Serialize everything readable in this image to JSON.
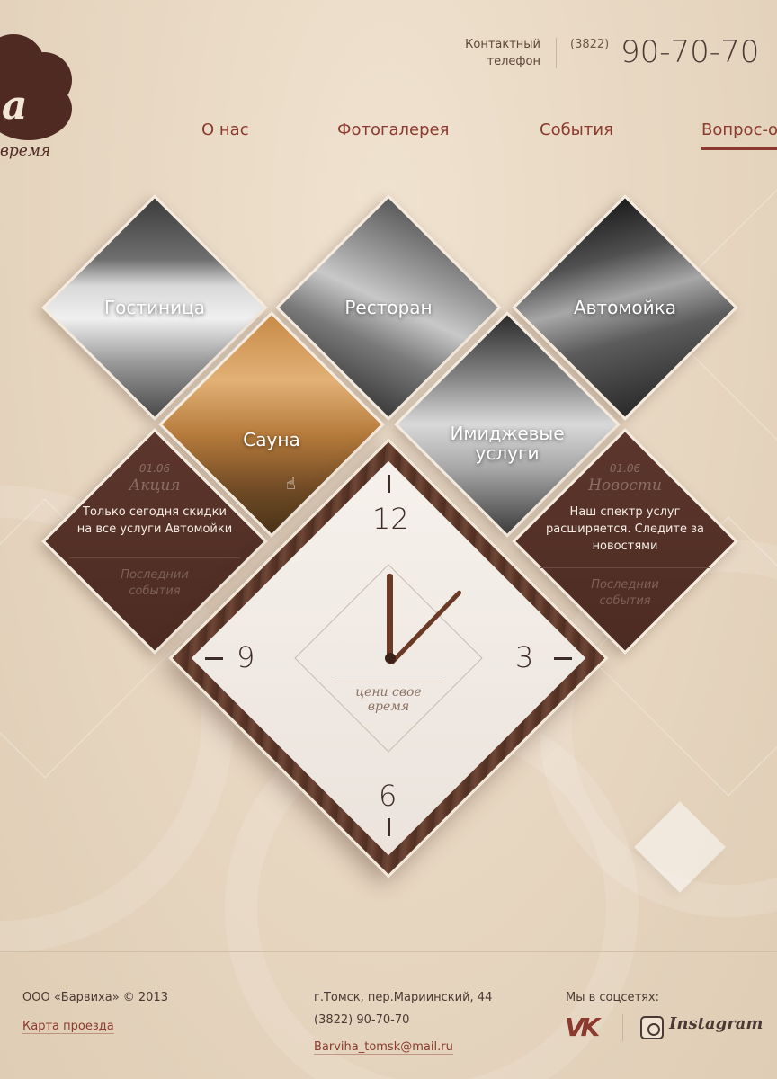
{
  "logo": {
    "letters": "a",
    "tagline": "время"
  },
  "contact": {
    "label_line1": "Контактный",
    "label_line2": "телефон",
    "code": "(3822)",
    "phone": "90-70-70"
  },
  "nav": {
    "items": [
      {
        "label": "О нас"
      },
      {
        "label": "Фотогалерея"
      },
      {
        "label": "События"
      },
      {
        "label": "Вопрос-о"
      }
    ],
    "active_index": 3
  },
  "tiles": {
    "hotel": "Гостиница",
    "restaurant": "Ресторан",
    "carwash": "Автомойка",
    "sauna": "Сауна",
    "image_services_line1": "Имиджевые",
    "image_services_line2": "услуги"
  },
  "promo": {
    "date": "01.06",
    "title": "Акция",
    "text_line1": "Только сегодня скидки",
    "text_line2": "на все услуги Автомойки",
    "more_line1": "Последнии",
    "more_line2": "события"
  },
  "news": {
    "date": "01.06",
    "title": "Новости",
    "text_line1": "Наш спектр услуг",
    "text_line2": "расширяется. Следите за",
    "text_line3": "новостями",
    "more_line1": "Последнии",
    "more_line2": "события"
  },
  "clock": {
    "n12": "12",
    "n3": "3",
    "n6": "6",
    "n9": "9",
    "motto_line1": "цени свое",
    "motto_line2": "время"
  },
  "footer": {
    "copyright": "ООО «Барвиха» © 2013",
    "map_link": "Карта проезда",
    "address": "г.Томск, пер.Мариинский, 44",
    "phone": "(3822) 90-70-70",
    "email": "Barviha_tomsk@mail.ru",
    "social_label": "Мы в соцсетях:",
    "vk": "VK",
    "instagram": "Instagram"
  },
  "colors": {
    "accent": "#8a3a2e",
    "brown": "#4c2b22",
    "background": "#eadbc6"
  },
  "icons": [
    "vk-icon",
    "instagram-icon",
    "hand-pointer-icon"
  ]
}
